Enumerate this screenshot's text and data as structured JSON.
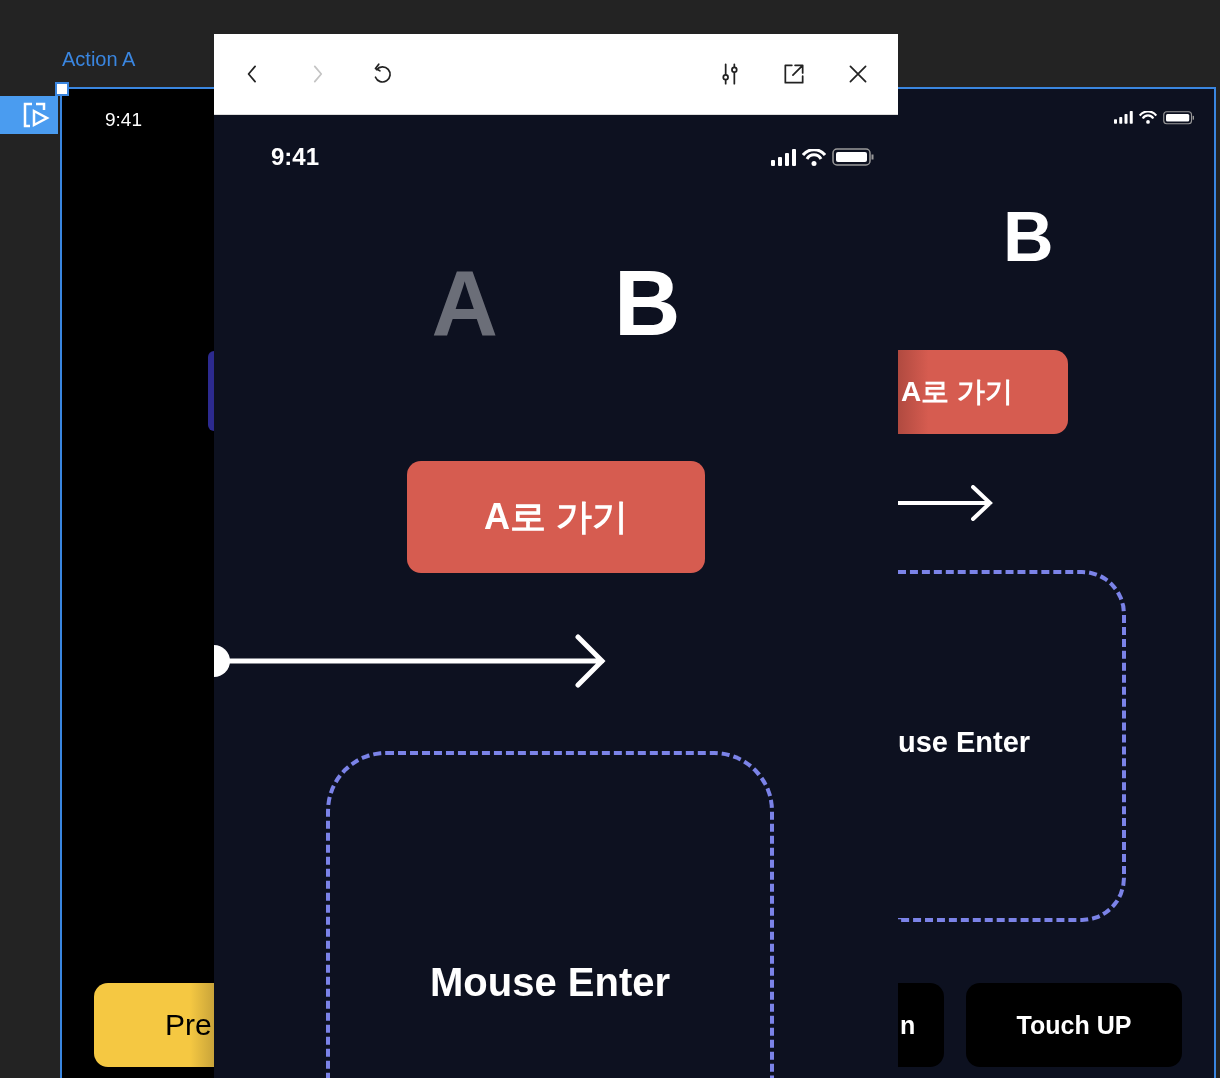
{
  "canvas": {
    "frame_label": "Action A",
    "left_screen": {
      "time": "9:41",
      "button": "Pre"
    },
    "right_screen": {
      "letter": "B",
      "button": "A로 가기",
      "box_label": "use Enter",
      "buttons": [
        {
          "label": "n"
        },
        {
          "label": "Touch UP"
        }
      ]
    }
  },
  "preview": {
    "toolbar": [
      {
        "kind": "back",
        "disabled": false
      },
      {
        "kind": "forward",
        "disabled": true
      },
      {
        "kind": "reload",
        "disabled": false
      },
      {
        "kind": "settings",
        "disabled": false
      },
      {
        "kind": "external",
        "disabled": false
      },
      {
        "kind": "close",
        "disabled": false
      }
    ],
    "phone": {
      "time": "9:41",
      "letters": [
        {
          "label": "A",
          "selected": false
        },
        {
          "label": "B",
          "selected": true
        }
      ],
      "button": "A로 가기",
      "box_label": "Mouse Enter"
    }
  }
}
